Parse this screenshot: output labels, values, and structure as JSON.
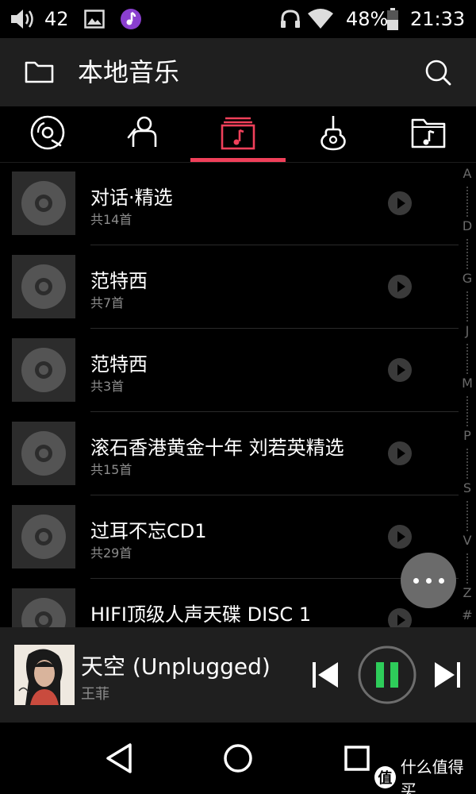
{
  "status_bar": {
    "volume_level": "42",
    "battery": "48%",
    "time": "21:33",
    "icons": [
      "volume-icon",
      "image-notification-icon",
      "music-app-icon",
      "headphones-icon",
      "wifi-icon",
      "battery-icon"
    ]
  },
  "header": {
    "title": "本地音乐",
    "icons": [
      "folder-icon",
      "search-icon"
    ]
  },
  "tabs": {
    "items": [
      {
        "icon": "disc-icon"
      },
      {
        "icon": "artist-icon"
      },
      {
        "icon": "album-icon",
        "selected": true
      },
      {
        "icon": "guitar-icon"
      },
      {
        "icon": "music-folder-icon"
      }
    ],
    "accent_color": "#f0405a"
  },
  "list": {
    "items": [
      {
        "title": "对话·精选",
        "subtitle": "共14首"
      },
      {
        "title": "范特西",
        "subtitle": "共7首"
      },
      {
        "title": "范特西",
        "subtitle": "共3首"
      },
      {
        "title": "滚石香港黄金十年 刘若英精选",
        "subtitle": "共15首"
      },
      {
        "title": "过耳不忘CD1",
        "subtitle": "共29首"
      },
      {
        "title": "HIFI顶级人声天碟 DISC 1",
        "subtitle": ""
      }
    ]
  },
  "alphabet_index": {
    "letters": [
      "A",
      "D",
      "G",
      "J",
      "M",
      "P",
      "S",
      "V",
      "Z",
      "#"
    ]
  },
  "now_playing": {
    "title": "天空 (Unplugged)",
    "artist": "王菲",
    "state": "playing",
    "accent_color": "#2ecc5a"
  },
  "navbar": {
    "icons": [
      "back-icon",
      "home-icon",
      "recents-icon"
    ]
  },
  "watermark": {
    "badge": "值",
    "text": "什么值得买"
  }
}
